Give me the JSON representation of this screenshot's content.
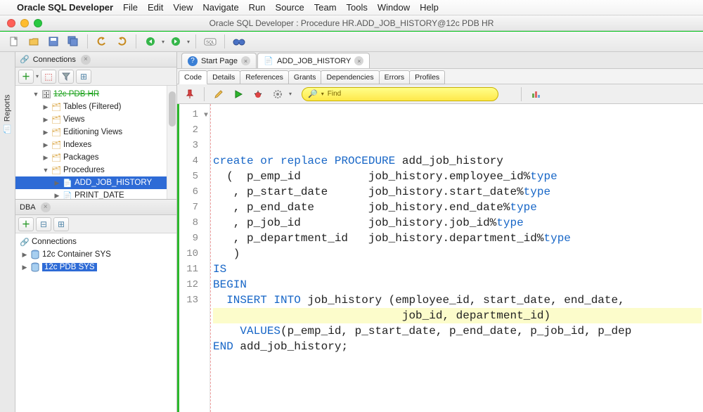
{
  "menubar": {
    "app": "Oracle SQL Developer",
    "items": [
      "File",
      "Edit",
      "View",
      "Navigate",
      "Run",
      "Source",
      "Team",
      "Tools",
      "Window",
      "Help"
    ]
  },
  "window_title": "Oracle SQL Developer : Procedure HR.ADD_JOB_HISTORY@12c PDB HR",
  "left": {
    "connections_label": "Connections",
    "dba_label": "DBA",
    "root_cut_label": "12c PDB HR",
    "tree1": [
      {
        "label": "Tables (Filtered)",
        "indent": 2
      },
      {
        "label": "Views",
        "indent": 2
      },
      {
        "label": "Editioning Views",
        "indent": 2
      },
      {
        "label": "Indexes",
        "indent": 2
      },
      {
        "label": "Packages",
        "indent": 2
      },
      {
        "label": "Procedures",
        "indent": 2,
        "expanded": true
      },
      {
        "label": "ADD_JOB_HISTORY",
        "indent": 3,
        "selected": true,
        "proc": true
      },
      {
        "label": "PRINT_DATE",
        "indent": 3,
        "proc": true
      }
    ],
    "dba_conn_label": "Connections",
    "dba_items": [
      {
        "label": "12c Container SYS"
      },
      {
        "label": "12c PDB SYS",
        "selected": true
      }
    ]
  },
  "editor_tabs": [
    {
      "label": "Start Page",
      "active": false,
      "icon": "help"
    },
    {
      "label": "ADD_JOB_HISTORY",
      "active": true,
      "icon": "proc"
    }
  ],
  "sub_tabs": [
    "Code",
    "Details",
    "References",
    "Grants",
    "Dependencies",
    "Errors",
    "Profiles"
  ],
  "active_sub_tab": "Code",
  "find_placeholder": "Find",
  "code": {
    "lines": [
      {
        "n": 1,
        "seg": [
          [
            "kw",
            "create or replace"
          ],
          [
            "plain",
            " "
          ],
          [
            "kw",
            "PROCEDURE"
          ],
          [
            "plain",
            " add_job_history"
          ]
        ]
      },
      {
        "n": 2,
        "seg": [
          [
            "plain",
            "  (  p_emp_id          job_history.employee_id%"
          ],
          [
            "kw",
            "type"
          ]
        ]
      },
      {
        "n": 3,
        "seg": [
          [
            "plain",
            "   , p_start_date      job_history.start_date%"
          ],
          [
            "kw",
            "type"
          ]
        ]
      },
      {
        "n": 4,
        "seg": [
          [
            "plain",
            "   , p_end_date        job_history.end_date%"
          ],
          [
            "kw",
            "type"
          ]
        ]
      },
      {
        "n": 5,
        "seg": [
          [
            "plain",
            "   , p_job_id          job_history.job_id%"
          ],
          [
            "kw",
            "type"
          ]
        ]
      },
      {
        "n": 6,
        "seg": [
          [
            "plain",
            "   , p_department_id   job_history.department_id%"
          ],
          [
            "kw",
            "type"
          ]
        ]
      },
      {
        "n": 7,
        "seg": [
          [
            "plain",
            "   )"
          ]
        ]
      },
      {
        "n": 8,
        "seg": [
          [
            "kw",
            "IS"
          ]
        ]
      },
      {
        "n": 9,
        "seg": [
          [
            "kw",
            "BEGIN"
          ]
        ]
      },
      {
        "n": 10,
        "seg": [
          [
            "plain",
            "  "
          ],
          [
            "kw",
            "INSERT"
          ],
          [
            "plain",
            " "
          ],
          [
            "kw",
            "INTO"
          ],
          [
            "plain",
            " job_history (employee_id, start_date, end_date,"
          ]
        ]
      },
      {
        "n": 11,
        "hl": true,
        "seg": [
          [
            "plain",
            "                            job_id, department_id)"
          ]
        ]
      },
      {
        "n": 12,
        "seg": [
          [
            "plain",
            "    "
          ],
          [
            "kw",
            "VALUES"
          ],
          [
            "plain",
            "(p_emp_id, p_start_date, p_end_date, p_job_id, p_dep"
          ]
        ]
      },
      {
        "n": 13,
        "seg": [
          [
            "kw",
            "END"
          ],
          [
            "plain",
            " add_job_history;"
          ]
        ]
      }
    ]
  },
  "reports_label": "Reports"
}
